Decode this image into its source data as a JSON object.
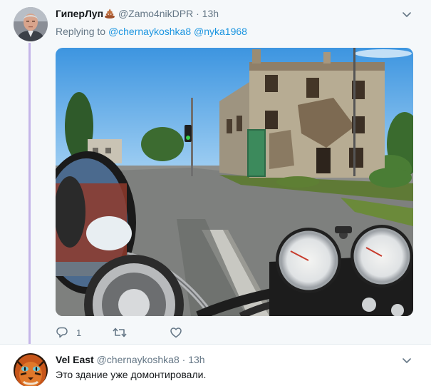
{
  "tweets": [
    {
      "display_name": "ГиперЛуп",
      "name_emoji": "pile-of-poo",
      "handle": "@Zamo4nikDPR",
      "separator": "·",
      "time": "13h",
      "replying_label": "Replying to",
      "replying_to": [
        "@chernaykoshka8",
        "@nyka1968"
      ],
      "photo": "street-scene-damaged-building-motorcycle",
      "reply_count": "1",
      "retweet_count": "",
      "like_count": ""
    },
    {
      "display_name": "Vel East",
      "handle": "@chernaykoshka8",
      "separator": "·",
      "time": "13h",
      "text": "Это здание уже домонтировали."
    }
  ],
  "colors": {
    "name": "#14171a",
    "secondary": "#657786",
    "link": "#1b95e0",
    "thread_line": "#c4b5e8",
    "background_highlight": "#f5f8fa"
  },
  "icons": [
    "chevron-down-icon",
    "reply-icon",
    "retweet-icon",
    "like-icon"
  ]
}
